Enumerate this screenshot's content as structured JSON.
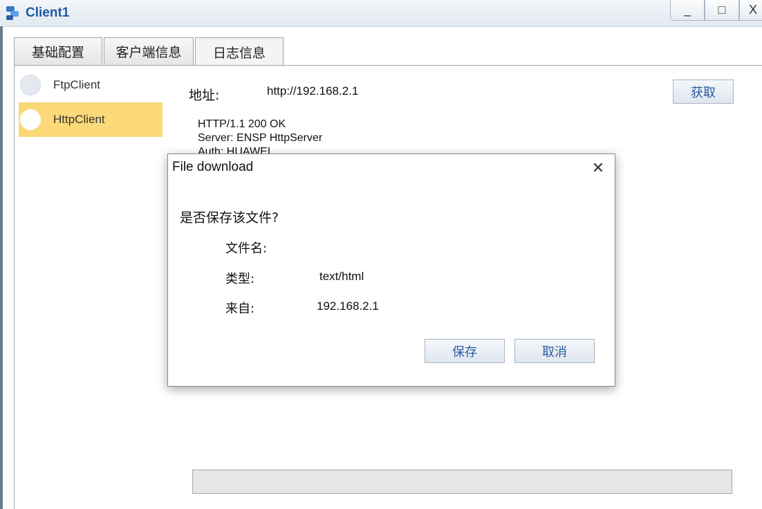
{
  "window": {
    "title": "Client1",
    "minimize_label": "_",
    "maximize_label": "□",
    "close_label": "X"
  },
  "tabs": [
    {
      "label": "基础配置"
    },
    {
      "label": "客户端信息"
    },
    {
      "label": "日志信息"
    }
  ],
  "sidebar": {
    "items": [
      {
        "label": "FtpClient",
        "selected": false
      },
      {
        "label": "HttpClient",
        "selected": true
      }
    ]
  },
  "main": {
    "address_label": "地址:",
    "address_value": "http://192.168.2.1",
    "fetch_button": "获取",
    "response_lines": [
      "HTTP/1.1 200 OK",
      "Server: ENSP HttpServer",
      "Auth: HUAWEI"
    ]
  },
  "dialog": {
    "title": "File download",
    "close_label": "✕",
    "question": "是否保存该文件?",
    "filename_label": "文件名:",
    "filename_value": "",
    "type_label": "类型:",
    "type_value": "text/html",
    "from_label": "来自:",
    "from_value": "192.168.2.1",
    "save_button": "保存",
    "cancel_button": "取消"
  },
  "colors": {
    "accent": "#1f5aa6",
    "selected_item": "#fbd978",
    "button_text": "#2a5a9e"
  }
}
